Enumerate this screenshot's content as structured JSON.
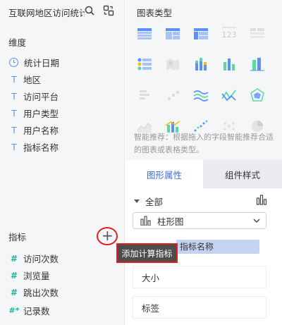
{
  "left": {
    "dataset_title": "互联网地区访问统计",
    "dimensions_title": "维度",
    "dimensions": [
      {
        "icon": "clock-icon",
        "label": "统计日期"
      },
      {
        "icon": "text-type-icon",
        "glyph": "T",
        "label": "地区"
      },
      {
        "icon": "text-type-icon",
        "glyph": "T",
        "label": "访问平台"
      },
      {
        "icon": "text-type-icon",
        "glyph": "T",
        "label": "用户类型"
      },
      {
        "icon": "text-type-icon",
        "glyph": "T",
        "label": "用户名称"
      },
      {
        "icon": "text-type-icon",
        "glyph": "T",
        "label": "指标名称"
      }
    ],
    "metrics_title": "指标",
    "add_button": "+",
    "metrics": [
      {
        "glyph": "#",
        "label": "访问次数"
      },
      {
        "glyph": "#",
        "label": "浏览量"
      },
      {
        "glyph": "#",
        "label": "跳出次数"
      },
      {
        "glyph": "#*",
        "label": "记录数"
      }
    ]
  },
  "tooltip": "添加计算指标",
  "right": {
    "title": "图表类型",
    "chart_types": [
      "table-icon",
      "pivot-table-icon",
      "cross-table-icon",
      "number-card-icon",
      "detail-table-icon",
      "kpi-list-icon",
      "map-heat-icon",
      "stacked-column-icon",
      "column-chart-icon",
      "bar-chart-icon",
      "horizontal-stacked-bar-icon",
      "waterfall-icon",
      "multi-line-icon",
      "radar-line-icon",
      "radar-icon",
      "area-chart-icon",
      "combo-chart-icon",
      "scatter-icon",
      "bubble-icon",
      "pie-chart-icon"
    ],
    "chart_type_glyph": "123",
    "hint": "智能推荐：根据拖入的字段智能推荐合适的图表或表格类型。",
    "tabs": {
      "active": "图形属性",
      "inactive": "组件样式"
    },
    "all_label": "全部",
    "selected_chart": "柱形图",
    "dropped_field": "指标名称",
    "blocks": [
      "大小",
      "标签"
    ]
  },
  "colors": {
    "accent": "#3a6fd8",
    "highlight_red": "#e02020",
    "tooltip_bg": "#4d4d4d",
    "pill_bg": "#c5d3f3"
  }
}
